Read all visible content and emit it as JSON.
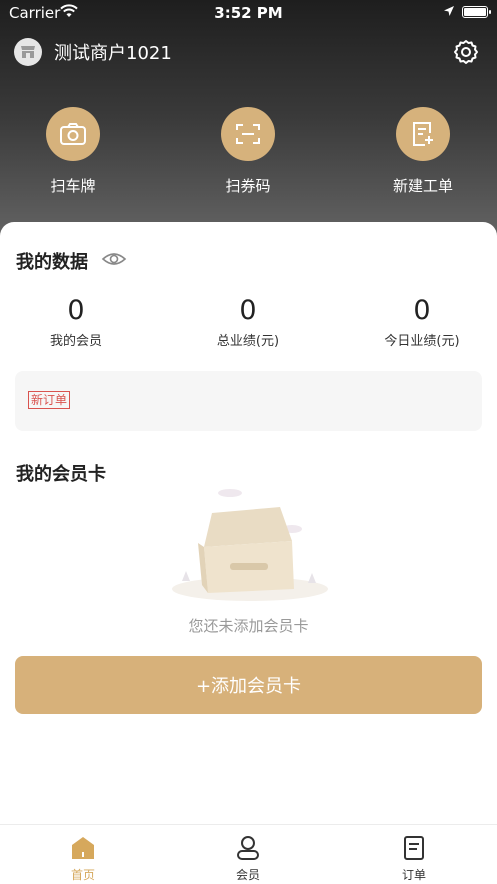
{
  "status_bar": {
    "carrier": "Carrier",
    "time": "3:52 PM"
  },
  "header": {
    "merchant_name": "测试商户1021"
  },
  "quick_actions": [
    {
      "label": "扫车牌",
      "icon": "camera-icon"
    },
    {
      "label": "扫券码",
      "icon": "scan-icon"
    },
    {
      "label": "新建工单",
      "icon": "new-order-icon"
    }
  ],
  "my_data": {
    "title": "我的数据",
    "stats": [
      {
        "value": "0",
        "label": "我的会员"
      },
      {
        "value": "0",
        "label": "总业绩(元)"
      },
      {
        "value": "0",
        "label": "今日业绩(元)"
      }
    ],
    "new_order_tag": "新订单"
  },
  "member_cards": {
    "title": "我的会员卡",
    "empty_text": "您还未添加会员卡",
    "add_button": "+添加会员卡"
  },
  "tabbar": [
    {
      "label": "首页",
      "icon": "home-icon",
      "active": true
    },
    {
      "label": "会员",
      "icon": "member-icon",
      "active": false
    },
    {
      "label": "订单",
      "icon": "order-icon",
      "active": false
    }
  ],
  "colors": {
    "accent": "#d7b17a",
    "active_tab": "#d6a85c",
    "tag_red": "#d9534f"
  }
}
